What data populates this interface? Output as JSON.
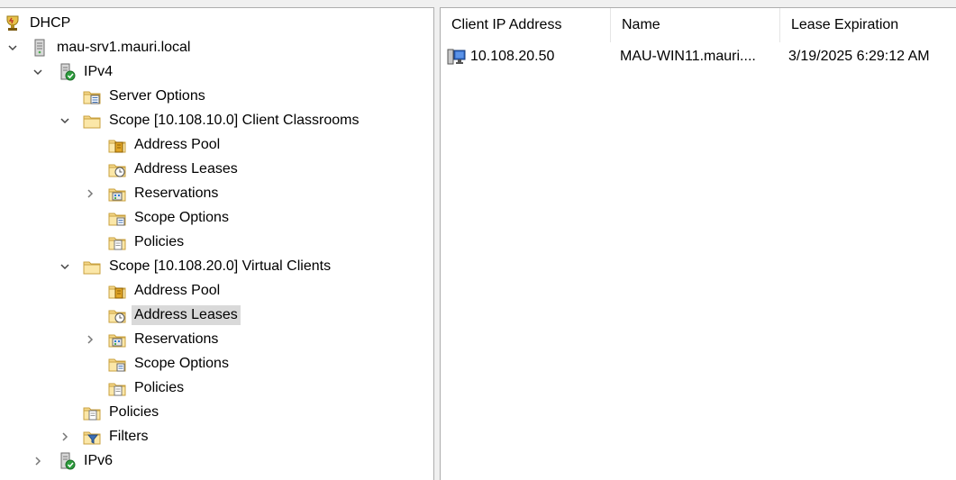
{
  "tree": {
    "root": {
      "label": "DHCP",
      "icon": "dhcp-root-icon"
    },
    "server": {
      "label": "mau-srv1.mauri.local",
      "icon": "server-icon"
    },
    "ipv4": {
      "label": "IPv4",
      "icon": "ipv4-icon"
    },
    "server_options": {
      "label": "Server Options",
      "icon": "server-options-icon"
    },
    "scope1": {
      "label": "Scope [10.108.10.0] Client Classrooms",
      "children": {
        "pool": "Address Pool",
        "leases": "Address Leases",
        "reservations": "Reservations",
        "scope_options": "Scope Options",
        "policies": "Policies"
      }
    },
    "scope2": {
      "label": "Scope [10.108.20.0] Virtual Clients",
      "children": {
        "pool": "Address Pool",
        "leases": "Address Leases",
        "reservations": "Reservations",
        "scope_options": "Scope Options",
        "policies": "Policies"
      }
    },
    "policies": {
      "label": "Policies"
    },
    "filters": {
      "label": "Filters"
    },
    "ipv6": {
      "label": "IPv6"
    }
  },
  "list": {
    "columns": [
      "Client IP Address",
      "Name",
      "Lease Expiration"
    ],
    "rows": [
      {
        "ip": "10.108.20.50",
        "name": "MAU-WIN11.mauri....",
        "expiration": "3/19/2025 6:29:12 AM"
      }
    ]
  },
  "colors": {
    "selection": "#d9d9d9",
    "folder": "#f3d27a",
    "border": "#adadad"
  }
}
